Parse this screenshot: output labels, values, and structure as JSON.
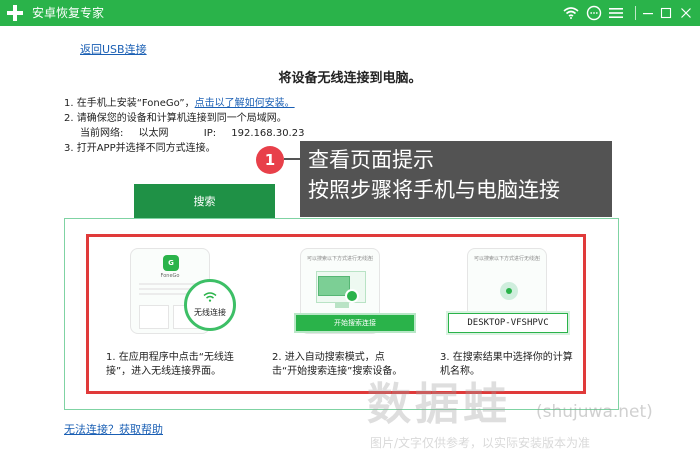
{
  "titlebar": {
    "title": "安卓恢复专家",
    "icons": [
      "wifi-icon",
      "chat-icon",
      "menu-icon",
      "minimize-icon",
      "maximize-icon",
      "close-icon"
    ]
  },
  "back_link": "返回USB连接",
  "heading": "将设备无线连接到电脑。",
  "steps": {
    "s1_prefix": "1.  在手机上安装“FoneGo”，",
    "s1_link": "点击以了解如何安装。",
    "s2": "2.  请确保您的设备和计算机连接到同一个局域网。",
    "network_label": "当前网络:",
    "network_value": "以太网",
    "ip_label": "IP:",
    "ip_value": "192.168.30.23",
    "s3": "3.  打开APP并选择不同方式连接。"
  },
  "callout": {
    "badge": "1",
    "line1": "查看页面提示",
    "line2": "按照步骤将手机与电脑连接"
  },
  "tab": {
    "search": "搜索"
  },
  "cards": {
    "c1": {
      "app_name": "FoneGo",
      "bubble_label": "无线连接"
    },
    "c2": {
      "title": "可以搜索以下方式进行无线连接",
      "button": "开始搜索连接"
    },
    "c3": {
      "title": "可以搜索以下方式进行无线连接",
      "device": "DESKTOP-VFSHPVC"
    }
  },
  "descriptions": {
    "d1a": "1.  在应用程序中点击“无线连",
    "d1b": "接”，进入无线连接界面。",
    "d2a": "2.  进入自动搜索模式，点",
    "d2b": "击“开始搜索连接”搜索设备。",
    "d3a": "3.  在搜索结果中选择你的计算",
    "d3b": "机名称。"
  },
  "watermark": {
    "main": "数据蛙",
    "site": "(shujuwa.net)",
    "note": "图片/文字仅供参考，以实际安装版本为准"
  },
  "help_link": "无法连接？获取帮助",
  "colors": {
    "brand_green": "#2ab34a",
    "tab_green": "#1f9146",
    "highlight_red": "#e03a3a",
    "badge_red": "#e8404a"
  }
}
